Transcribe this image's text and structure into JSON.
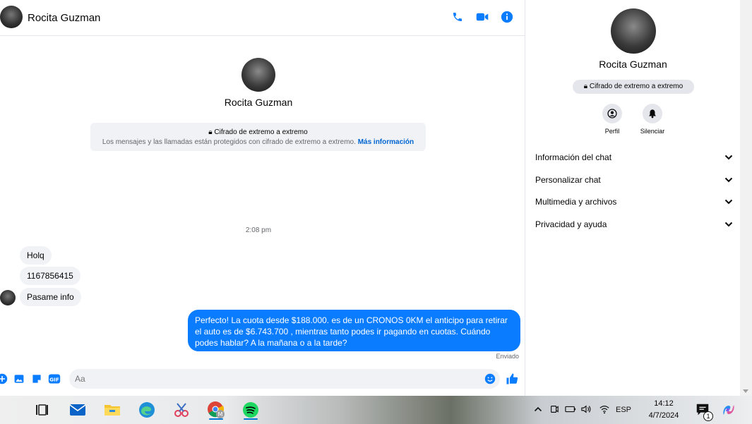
{
  "contact": {
    "name": "Rocita Guzman"
  },
  "header": {
    "call_icon": "phone-icon",
    "video_icon": "video-camera-icon",
    "info_icon": "info-icon"
  },
  "encryption": {
    "title": "Cifrado de extremo a extremo",
    "description": "Los mensajes y las llamadas están protegidos con cifrado de extremo a extremo.",
    "link": "Más información"
  },
  "conversation": {
    "timestamp": "2:08 pm",
    "incoming": [
      "Holq",
      "1167856415",
      "Pasame info"
    ],
    "outgoing": "Perfecto! La cuota desde $188.000. es de un CRONOS 0KM el anticipo para retirar el auto es de $6.743.700 , mientras tanto podes ir pagando en cuotas. Cuándo podes hablar? A la mañana o a la tarde?",
    "outgoing_status": "Enviado"
  },
  "composer": {
    "placeholder": "Aa"
  },
  "details": {
    "encryption_badge": "Cifrado de extremo a extremo",
    "actions": [
      {
        "label": "Perfil",
        "icon": "profile-icon"
      },
      {
        "label": "Silenciar",
        "icon": "bell-icon"
      }
    ],
    "sections": [
      "Información del chat",
      "Personalizar chat",
      "Multimedia y archivos",
      "Privacidad y ayuda"
    ]
  },
  "taskbar": {
    "language": "ESP",
    "time": "14:12",
    "date": "4/7/2024",
    "notification_count": "1",
    "chrome_badge": "M"
  },
  "colors": {
    "accent": "#0a7cff",
    "link": "#0064d1",
    "bubble_in": "#f0f2f5"
  }
}
